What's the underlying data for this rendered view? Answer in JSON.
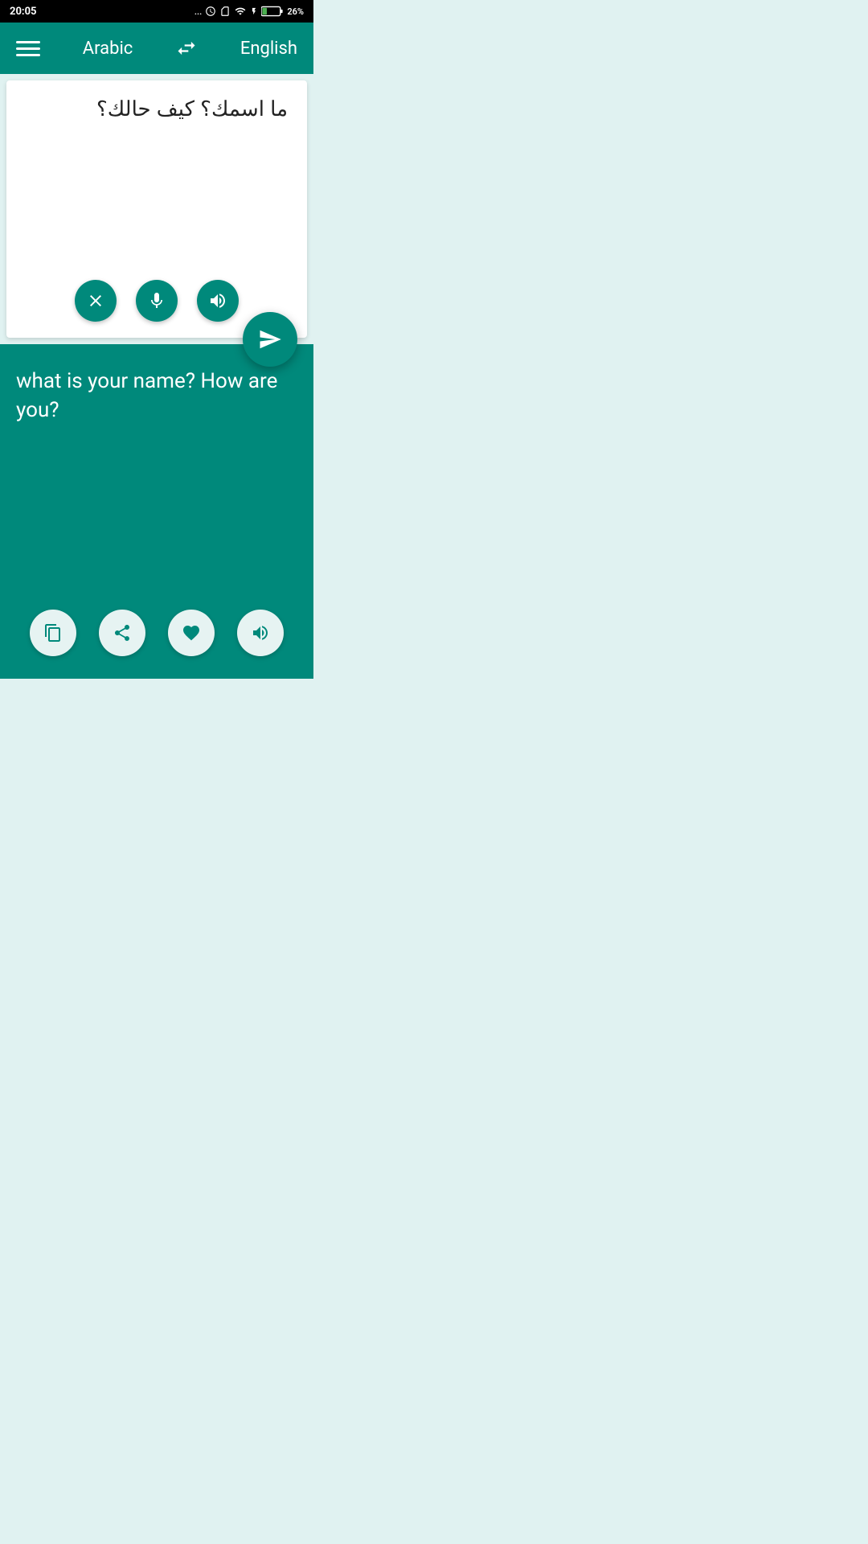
{
  "statusBar": {
    "time": "20:05",
    "battery": "26%",
    "dots": "..."
  },
  "header": {
    "sourceLanguage": "Arabic",
    "targetLanguage": "English",
    "swapLabel": "swap"
  },
  "inputPanel": {
    "arabicText": "ما اسمك؟ كيف حالك؟",
    "clearLabel": "clear",
    "micLabel": "microphone",
    "speakerLabel": "speaker"
  },
  "outputPanel": {
    "translatedText": "what is your name? How are you?",
    "copyLabel": "copy",
    "shareLabel": "share",
    "favoriteLabel": "favorite",
    "speakerLabel": "speaker"
  },
  "sendButton": {
    "label": "send"
  }
}
